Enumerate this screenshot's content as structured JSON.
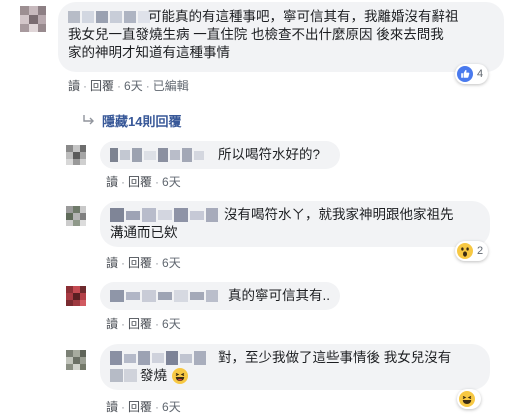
{
  "comments": [
    {
      "text": "可能真的有這種事吧，寧可信其有，我離婚沒有辭祖\n我女兒一直發燒生病 一直住院 也檢查不出什麼原因 後來去問我\n家的神明才知道有這種事情",
      "actions": {
        "reply": "讀",
        "reply2": "回覆",
        "time": "6天",
        "edited": "已編輯"
      },
      "reaction": {
        "icon": "like-icon",
        "count": "4"
      }
    }
  ],
  "hidden_replies": {
    "label": "隱藏14則回覆"
  },
  "replies": [
    {
      "text": "所以喝符水好的?",
      "actions": {
        "reply": "讀",
        "reply2": "回覆",
        "time": "6天"
      }
    },
    {
      "text_line1": "沒有喝符水ㄚ，就我家神明跟他家祖先",
      "text_line2": "溝通而已欸",
      "actions": {
        "reply": "讀",
        "reply2": "回覆",
        "time": "6天"
      },
      "reaction": {
        "icon": "wow-icon",
        "count": "2"
      }
    },
    {
      "text": "真的寧可信其有..",
      "actions": {
        "reply": "讀",
        "reply2": "回覆",
        "time": "6天"
      }
    },
    {
      "text_line1": "對，至少我做了這些事情後 我女兒沒有",
      "text_line2": "發燒",
      "actions": {
        "reply": "讀",
        "reply2": "回覆",
        "time": "6天"
      },
      "reaction": {
        "icon": "haha-icon",
        "count": ""
      }
    }
  ]
}
